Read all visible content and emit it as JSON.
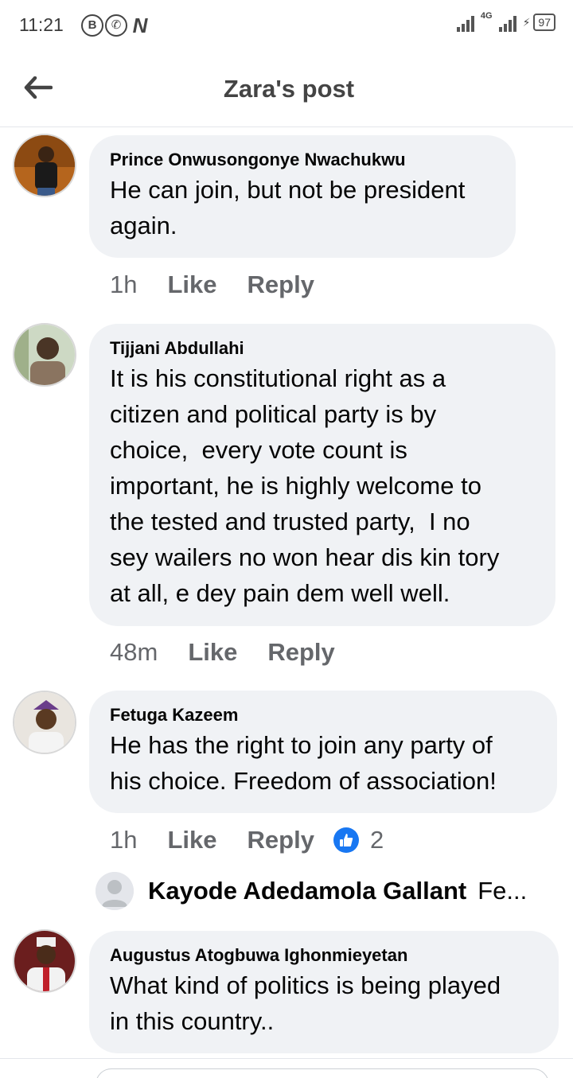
{
  "status_bar": {
    "time": "11:21",
    "network": "4G",
    "battery": "97"
  },
  "header": {
    "title": "Zara's post"
  },
  "comments": [
    {
      "author": "Prince Onwusongonye Nwachukwu",
      "text": "He can join, but not be president\nagain.",
      "time": "1h",
      "like_label": "Like",
      "reply_label": "Reply"
    },
    {
      "author": "Tijjani Abdullahi",
      "text": "It is his constitutional right as a\ncitizen and political party is by\nchoice,  every vote count is\nimportant, he is highly welcome to\nthe tested and trusted party,  I no\nsey wailers no won hear dis kin tory\nat all, e dey pain dem well well.",
      "time": "48m",
      "like_label": "Like",
      "reply_label": "Reply"
    },
    {
      "author": "Fetuga Kazeem",
      "text": "He has the right to join any party of\nhis choice. Freedom of association!",
      "time": "1h",
      "like_label": "Like",
      "reply_label": "Reply",
      "reaction_count": "2"
    },
    {
      "author": "Augustus Atogbuwa Ighonmieyetan",
      "text": "What kind of politics is being played\nin this country..",
      "time": "",
      "like_label": "",
      "reply_label": ""
    }
  ],
  "reply_preview": {
    "author": "Kayode Adedamola Gallant",
    "snippet": "Fe..."
  },
  "colors": {
    "bubble": "#f0f2f5",
    "secondary_text": "#65676b",
    "like_blue": "#1877f2"
  }
}
